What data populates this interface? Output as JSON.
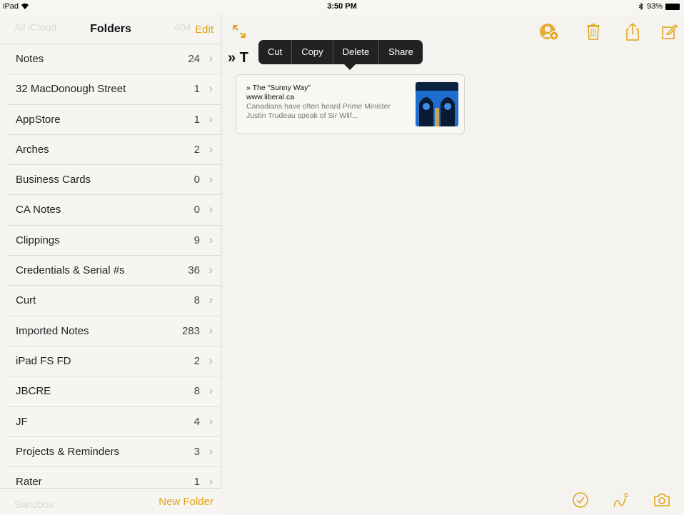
{
  "status": {
    "device": "iPad",
    "time": "3:50 PM",
    "battery": "93%"
  },
  "sidebar": {
    "ghost_top": "All iCloud",
    "ghost_top_count": "404",
    "title": "Folders",
    "edit_label": "Edit",
    "new_folder_label": "New Folder",
    "ghost_bottom": "Sandbox",
    "folders": [
      {
        "name": "Notes",
        "count": "24"
      },
      {
        "name": "32 MacDonough Street",
        "count": "1"
      },
      {
        "name": "AppStore",
        "count": "1"
      },
      {
        "name": "Arches",
        "count": "2"
      },
      {
        "name": "Business Cards",
        "count": "0"
      },
      {
        "name": "CA Notes",
        "count": "0"
      },
      {
        "name": "Clippings",
        "count": "9"
      },
      {
        "name": "Credentials & Serial #s",
        "count": "36"
      },
      {
        "name": "Curt",
        "count": "8"
      },
      {
        "name": "Imported Notes",
        "count": "283"
      },
      {
        "name": "iPad FS FD",
        "count": "2"
      },
      {
        "name": "JBCRE",
        "count": "8"
      },
      {
        "name": "JF",
        "count": "4"
      },
      {
        "name": "Projects & Reminders",
        "count": "3"
      },
      {
        "name": "Rater",
        "count": "1"
      }
    ]
  },
  "main": {
    "note_title": "» T",
    "popover": {
      "cut": "Cut",
      "copy": "Copy",
      "delete": "Delete",
      "share": "Share"
    },
    "link_card": {
      "title": "» The “Sunny Way”",
      "url": "www.liberal.ca",
      "description": "Canadians have often heard Prime Minister Justin Trudeau speak of Sir Wilf..."
    }
  },
  "colors": {
    "accent": "#e2a214",
    "background": "#f4f3ef",
    "popover": "#222222"
  },
  "icons": {
    "toolbar": [
      "add-person-icon",
      "trash-icon",
      "share-icon",
      "compose-icon"
    ],
    "bottom": [
      "checklist-icon",
      "sketch-icon",
      "camera-icon"
    ],
    "expand": "expand-icon"
  }
}
